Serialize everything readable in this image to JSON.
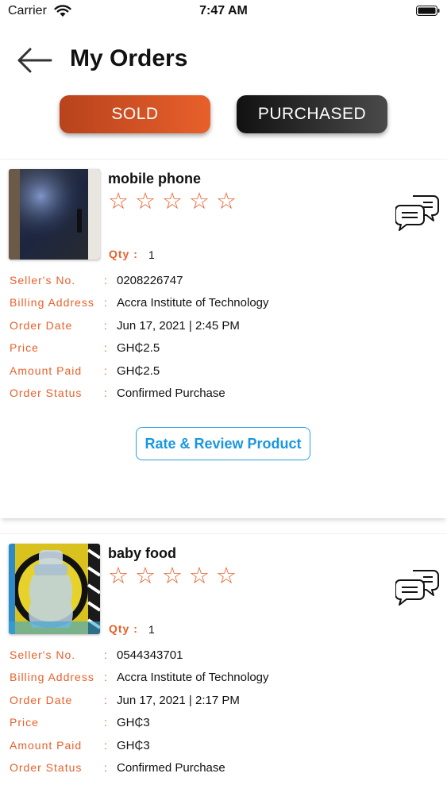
{
  "status_bar": {
    "carrier": "Carrier",
    "time": "7:47 AM"
  },
  "header": {
    "title": "My Orders"
  },
  "tabs": {
    "sold_label": "SOLD",
    "purchased_label": "PURCHASED",
    "active": "sold"
  },
  "colors": {
    "accent": "#e8602b",
    "link": "#1a96e3",
    "dark_tab": "#222222"
  },
  "orders": [
    {
      "product_name": "mobile phone",
      "rating_stars": 0,
      "rating_max": 5,
      "qty_label": "Qty :",
      "qty": "1",
      "details": [
        {
          "label": "Seller's No.",
          "value": "0208226747"
        },
        {
          "label": "Billing Address",
          "value": "Accra Institute of Technology"
        },
        {
          "label": "Order Date",
          "value": "Jun 17, 2021 | 2:45 PM"
        },
        {
          "label": "Price",
          "value": "GH₵2.5"
        },
        {
          "label": "Amount Paid",
          "value": "GH₵2.5"
        },
        {
          "label": "Order Status",
          "value": "Confirmed Purchase"
        }
      ],
      "action_label": "Rate & Review Product"
    },
    {
      "product_name": "baby food",
      "rating_stars": 0,
      "rating_max": 5,
      "qty_label": "Qty :",
      "qty": "1",
      "details": [
        {
          "label": "Seller's No.",
          "value": "0544343701"
        },
        {
          "label": "Billing Address",
          "value": "Accra Institute of Technology"
        },
        {
          "label": "Order Date",
          "value": "Jun 17, 2021 | 2:17 PM"
        },
        {
          "label": "Price",
          "value": "GH₵3"
        },
        {
          "label": "Amount Paid",
          "value": "GH₵3"
        },
        {
          "label": "Order Status",
          "value": "Confirmed Purchase"
        }
      ]
    }
  ],
  "detail_separator": ":",
  "icons": {
    "star": "star-outline-icon",
    "chat": "chat-bubbles-icon",
    "back": "arrow-left-icon"
  }
}
